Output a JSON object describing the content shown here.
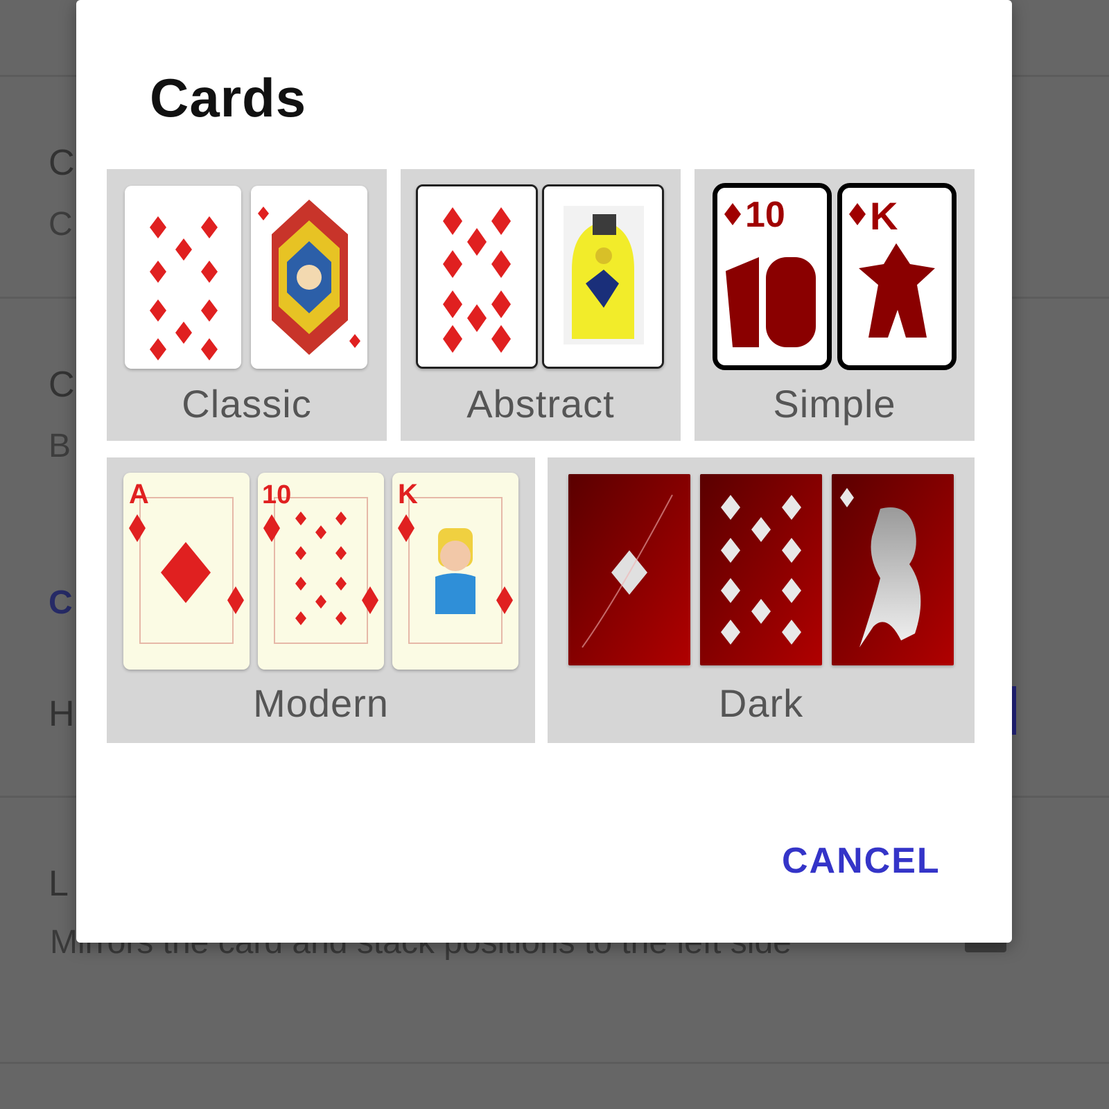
{
  "dialog": {
    "title": "Cards",
    "cancel_label": "CANCEL"
  },
  "styles": [
    {
      "label": "Classic"
    },
    {
      "label": "Abstract"
    },
    {
      "label": "Simple"
    },
    {
      "label": "Modern"
    },
    {
      "label": "Dark"
    }
  ],
  "cards": {
    "ten": "10",
    "king": "K",
    "ace": "A"
  },
  "background": {
    "left_letters": [
      "C",
      "C",
      "C",
      "B",
      "C",
      "H",
      "L"
    ],
    "description": "Mirrors the card and stack positions to the left side"
  },
  "colors": {
    "accent": "#3434c8",
    "card_red": "#e02020",
    "dark_card": "#8a0000",
    "tile": "#d6d6d6"
  }
}
